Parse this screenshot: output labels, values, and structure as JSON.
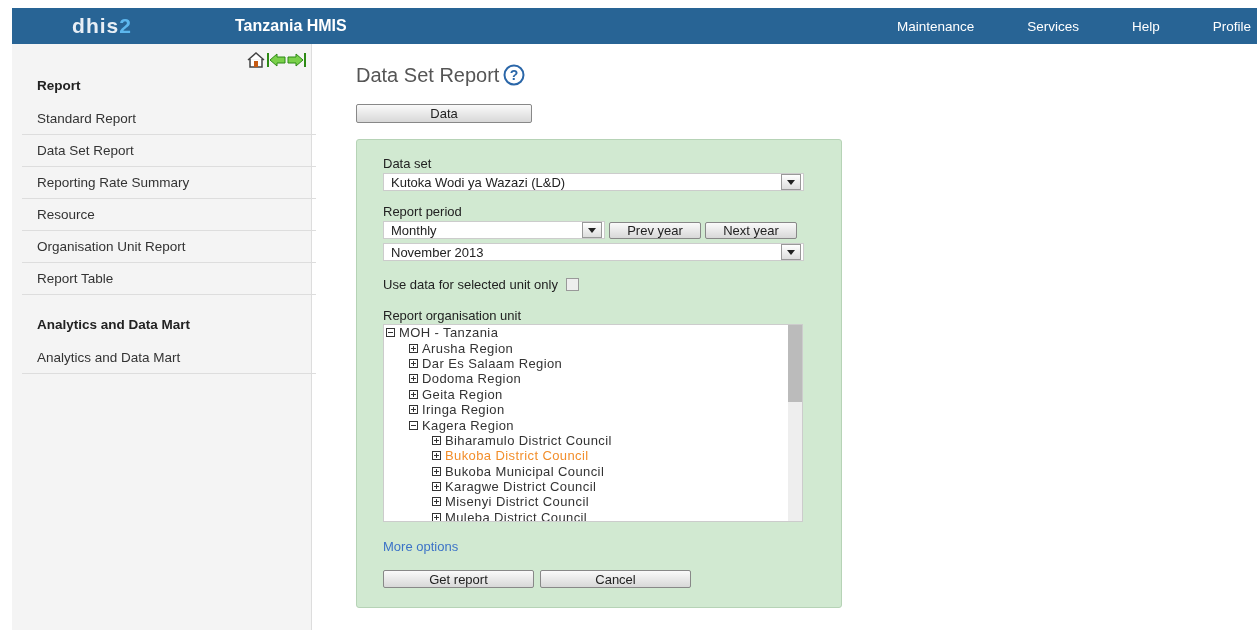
{
  "header": {
    "logo": {
      "text": "dhis",
      "accent": "2"
    },
    "title": "Tanzania HMIS",
    "menu": [
      "Maintenance",
      "Services",
      "Help",
      "Profile"
    ]
  },
  "sidebar": {
    "sections": [
      {
        "heading": "Report",
        "items": [
          {
            "label": "Standard Report"
          },
          {
            "label": "Data Set Report"
          },
          {
            "label": "Reporting Rate Summary"
          },
          {
            "label": "Resource"
          },
          {
            "label": "Organisation Unit Report"
          },
          {
            "label": "Report Table"
          }
        ]
      },
      {
        "heading": "Analytics and Data Mart",
        "items": [
          {
            "label": "Analytics and Data Mart"
          }
        ]
      }
    ]
  },
  "page": {
    "title": "Data Set Report",
    "help_mark": "?",
    "tab_button": "Data"
  },
  "form": {
    "data_set": {
      "label": "Data set",
      "value": "Kutoka Wodi ya Wazazi (L&D)"
    },
    "report_period": {
      "label": "Report period",
      "period_type": "Monthly",
      "prev_button": "Prev year",
      "next_button": "Next year",
      "period": "November 2013"
    },
    "selected_unit_only": {
      "label": "Use data for selected unit only",
      "checked": false
    },
    "org_unit": {
      "label": "Report organisation unit",
      "tree": [
        {
          "label": "MOH - Tanzania",
          "expanded": true,
          "selected": false,
          "children": [
            {
              "label": "Arusha Region",
              "expanded": false,
              "selected": false
            },
            {
              "label": "Dar Es Salaam Region",
              "expanded": false,
              "selected": false
            },
            {
              "label": "Dodoma Region",
              "expanded": false,
              "selected": false
            },
            {
              "label": "Geita Region",
              "expanded": false,
              "selected": false
            },
            {
              "label": "Iringa Region",
              "expanded": false,
              "selected": false
            },
            {
              "label": "Kagera Region",
              "expanded": true,
              "selected": false,
              "children": [
                {
                  "label": "Biharamulo District Council",
                  "expanded": false,
                  "selected": false
                },
                {
                  "label": "Bukoba District Council",
                  "expanded": false,
                  "selected": true
                },
                {
                  "label": "Bukoba Municipal Council",
                  "expanded": false,
                  "selected": false
                },
                {
                  "label": "Karagwe District Council",
                  "expanded": false,
                  "selected": false
                },
                {
                  "label": "Misenyi District Council",
                  "expanded": false,
                  "selected": false
                },
                {
                  "label": "Muleba District Council",
                  "expanded": false,
                  "selected": false
                }
              ]
            }
          ]
        }
      ]
    },
    "more_options": "More options",
    "buttons": [
      "Get report",
      "Cancel"
    ]
  }
}
